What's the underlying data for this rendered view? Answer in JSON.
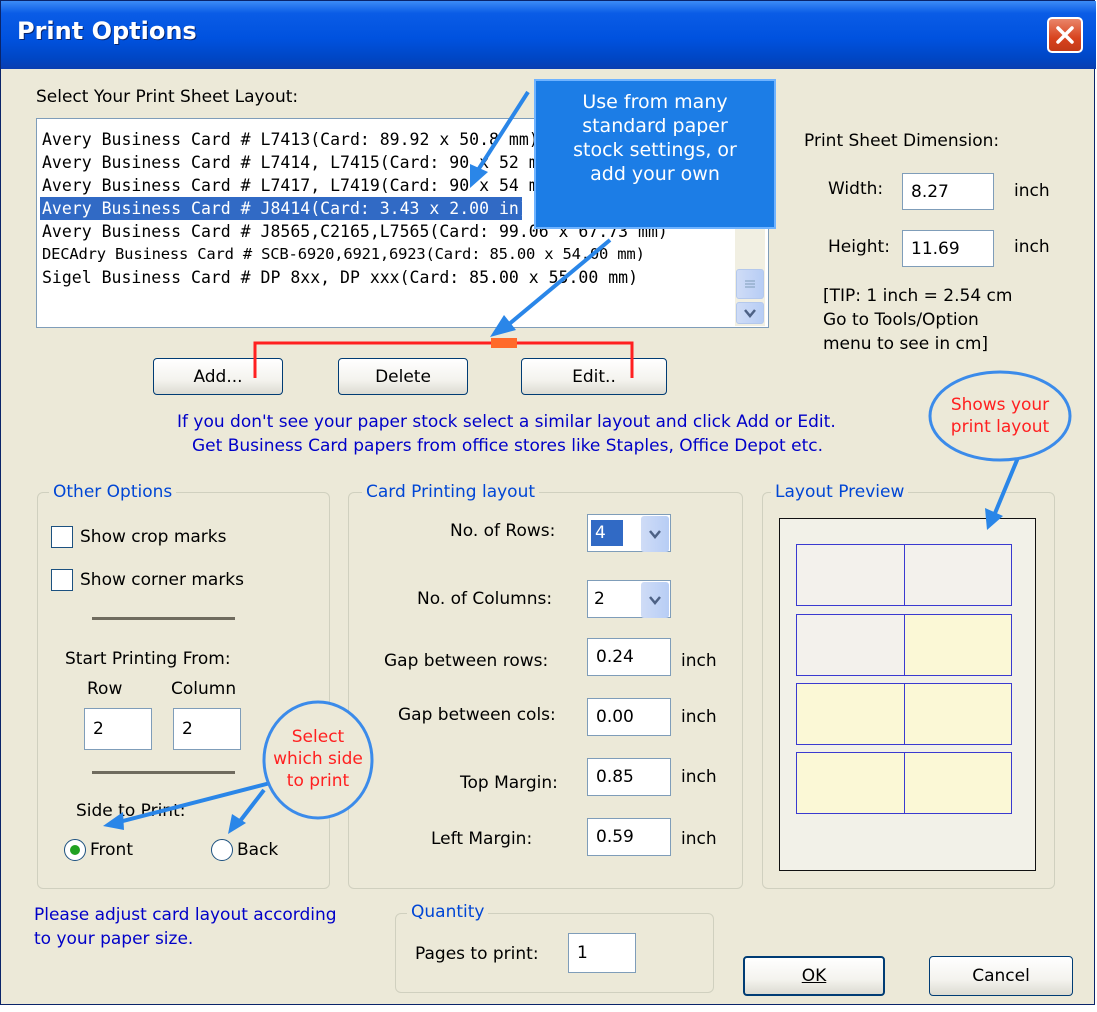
{
  "window": {
    "title": "Print Options"
  },
  "print_sheet_layout": {
    "label": "Select Your Print Sheet Layout:",
    "items": [
      "Avery Business Card # L7413(Card: 89.92 x 50.8 mm)",
      "Avery Business Card # L7414, L7415(Card: 90 x 52 mm)",
      "Avery Business Card # L7417, L7419(Card: 90 x 54 mm)",
      "Avery Business Card # J8414(Card: 3.43 x 2.00 in)",
      "Avery Business Card # J8565,C2165,L7565(Card: 99.06 x 67.73 mm)",
      "DECAdry Business Card # SCB-6920,6921,6923(Card: 85.00 x 54.00 mm)",
      "Sigel Business Card # DP 8xx, DP xxx(Card: 85.00 x 55.00 mm)"
    ],
    "selected_index": 3
  },
  "buttons": {
    "add": "Add...",
    "delete": "Delete",
    "edit": "Edit..",
    "ok": "OK",
    "cancel": "Cancel"
  },
  "dimension": {
    "label": "Print Sheet Dimension:",
    "width_label": "Width:",
    "width_value": "8.27",
    "width_unit": "inch",
    "height_label": "Height:",
    "height_value": "11.69",
    "height_unit": "inch",
    "tip_line1": "[TIP: 1 inch = 2.54 cm",
    "tip_line2": "Go to Tools/Option",
    "tip_line3": "menu to see in cm]"
  },
  "info": {
    "line1": "If you don't see your paper stock select a similar layout and click Add or Edit.",
    "line2": "Get Business Card papers from office stores like Staples, Office Depot etc."
  },
  "other_options": {
    "title": "Other Options",
    "crop_marks": "Show crop marks",
    "corner_marks": "Show corner marks",
    "start_label": "Start Printing From:",
    "row_label": "Row",
    "column_label": "Column",
    "row_value": "2",
    "column_value": "2",
    "side_label": "Side to Print:",
    "front": "Front",
    "back": "Back"
  },
  "card_layout": {
    "title": "Card Printing layout",
    "rows_label": "No. of Rows:",
    "rows_value": "4",
    "cols_label": "No. of Columns:",
    "cols_value": "2",
    "gap_rows_label": "Gap between rows:",
    "gap_rows_value": "0.24",
    "gap_cols_label": "Gap between cols:",
    "gap_cols_value": "0.00",
    "top_margin_label": "Top Margin:",
    "top_margin_value": "0.85",
    "left_margin_label": "Left Margin:",
    "left_margin_value": "0.59",
    "unit": "inch"
  },
  "preview": {
    "title": "Layout Preview",
    "colors": {
      "skipped": "#f3f1ec",
      "printed": "#fbf8d6",
      "border": "#3a3ad0"
    }
  },
  "footer": {
    "note_line1": "Please adjust card layout according",
    "note_line2": "to your paper size."
  },
  "quantity": {
    "title": "Quantity",
    "pages_label": "Pages to print:",
    "pages_value": "1"
  },
  "callouts": {
    "standard_paper": {
      "line1": "Use from many",
      "line2": "standard paper",
      "line3": "stock settings, or",
      "line4": "add your own"
    },
    "preview": {
      "line1": "Shows your",
      "line2": "print layout"
    },
    "side": {
      "line1": "Select",
      "line2": "which side",
      "line3": "to print"
    }
  }
}
